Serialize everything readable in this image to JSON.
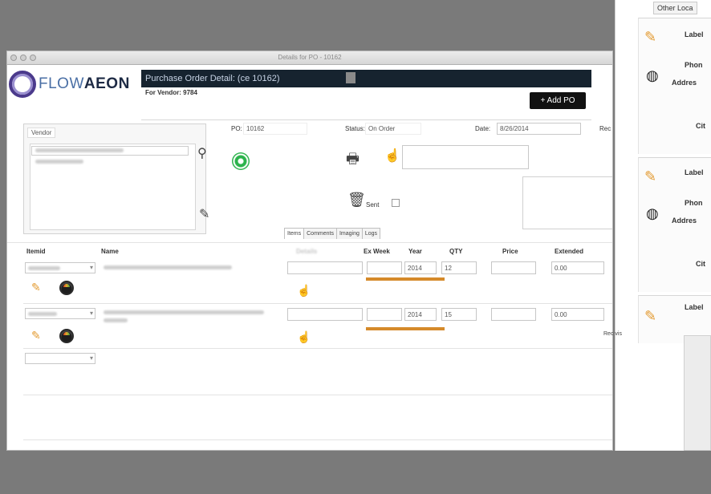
{
  "window": {
    "title": "Details for PO - 10162"
  },
  "logo": {
    "text_light": "FLOW",
    "text_bold": "AEON"
  },
  "header": {
    "title": "Purchase Order Detail: (ce 10162)",
    "subtitle": "For Vendor: 9784",
    "add_po_label": "+ Add PO"
  },
  "vendor": {
    "tab_label": "Vendor"
  },
  "po": {
    "po_label": "PO:",
    "po_value": "10162",
    "status_label": "Status:",
    "status_value": "On Order",
    "date_label": "Date:",
    "date_value": "8/26/2014",
    "rec_label": "Rec",
    "sent_label": "Sent"
  },
  "tabs": [
    "Items",
    "Comments",
    "Imaging",
    "Logs"
  ],
  "grid": {
    "headers": {
      "itemid": "Itemid",
      "name": "Name",
      "blurred": "Details",
      "ex_week": "Ex Week",
      "year": "Year",
      "qty": "QTY",
      "price": "Price",
      "extended": "Extended"
    },
    "rows": [
      {
        "year": "2014",
        "qty": "12",
        "extended": "0.00"
      },
      {
        "year": "2014",
        "qty": "15",
        "extended": "0.00"
      }
    ]
  },
  "right_panel": {
    "tab_label": "Other Loca",
    "label": "Label",
    "phone": "Phon",
    "address": "Addres",
    "city": "Cit",
    "rec_visible": "Rec vis"
  }
}
